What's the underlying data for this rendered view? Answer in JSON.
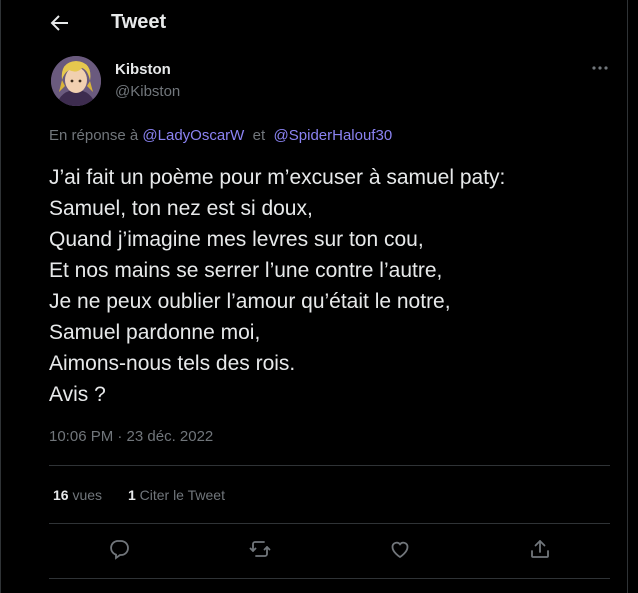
{
  "header": {
    "title": "Tweet"
  },
  "author": {
    "display_name": "Kibston",
    "handle": "@Kibston"
  },
  "reply": {
    "prefix": "En réponse à",
    "mention1": "@LadyOscarW",
    "connector": "et",
    "mention2": "@SpiderHalouf30"
  },
  "tweet": {
    "lines": [
      "J’ai fait un poème pour m’excuser à samuel paty:",
      "Samuel, ton nez est si doux,",
      "Quand j’imagine mes levres sur ton cou,",
      "Et nos mains se serrer l’une contre l’autre,",
      "Je ne peux oublier l’amour qu’était le notre,",
      "Samuel pardonne moi,",
      "Aimons-nous tels des rois.",
      "Avis ?"
    ],
    "timestamp": "10:06 PM · 23 déc. 2022"
  },
  "stats": {
    "views_count": "16",
    "views_label": "vues",
    "quotes_count": "1",
    "quotes_label": "Citer le Tweet"
  },
  "icons": {
    "back": "arrow-left-icon",
    "more": "more-horizontal-icon",
    "reply": "reply-icon",
    "retweet": "retweet-icon",
    "like": "heart-icon",
    "share": "share-icon"
  },
  "colors": {
    "background": "#000000",
    "text": "#e7e9ea",
    "muted": "#71767b",
    "mention": "#8b83f2",
    "border": "#2f3336"
  }
}
